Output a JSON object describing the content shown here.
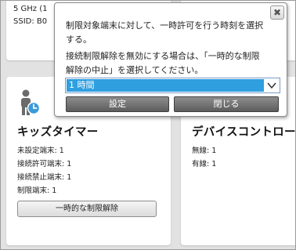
{
  "wifi": {
    "band_line": "5 GHz (1",
    "ssid_line": "SSID: B0"
  },
  "kids_timer": {
    "title": "キッズタイマー",
    "icon": "child-clock-icon",
    "stats": [
      "未設定端末: 1",
      "接続許可端末: 1",
      "接続禁止端末: 1",
      "制限端末: 1"
    ],
    "temp_release_button": "一時的な制限解除"
  },
  "device_control": {
    "title": "デバイスコントロール",
    "stats": [
      "無線: 1",
      "有線: 1"
    ]
  },
  "popup": {
    "close_icon": "close-icon",
    "close_glyph": "✖",
    "line1": "制限対象端末に対して、一時許可を行う時刻を選択",
    "line2": "する。",
    "line3": "接続制限解除を無効にする場合は、「一時的な制限",
    "line4": "解除の中止」を選択してください。",
    "select_value": "1 時間",
    "set_button": "設定",
    "close_button": "閉じる"
  },
  "colors": {
    "accent": "#2f9fe0",
    "button_dark": "#6f6f6f",
    "background": "#e2e2e2"
  }
}
